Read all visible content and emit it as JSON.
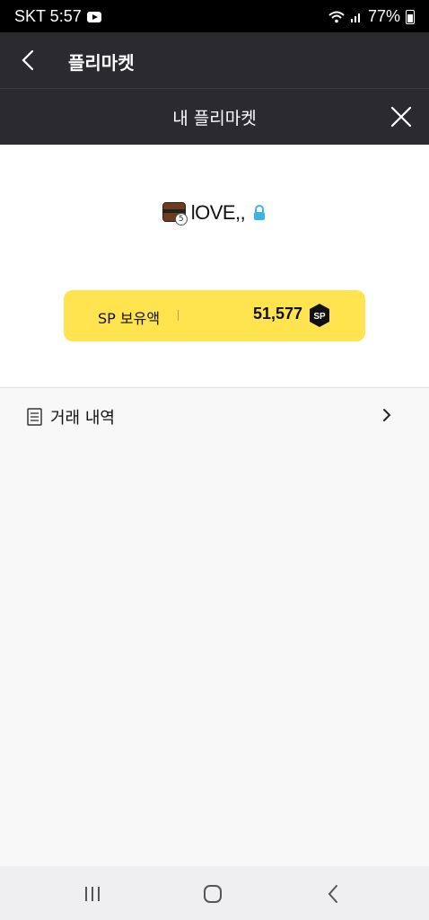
{
  "status": {
    "carrier_time": "SKT 5:57",
    "battery": "77%"
  },
  "appbar": {
    "title": "플리마켓"
  },
  "subheader": {
    "title": "내 플리마켓"
  },
  "profile": {
    "username": "lOVE,,",
    "avatar_level": "5"
  },
  "sp": {
    "label": "SP 보유액",
    "value": "51,577",
    "badge": "SP"
  },
  "history": {
    "label": "거래 내역"
  }
}
